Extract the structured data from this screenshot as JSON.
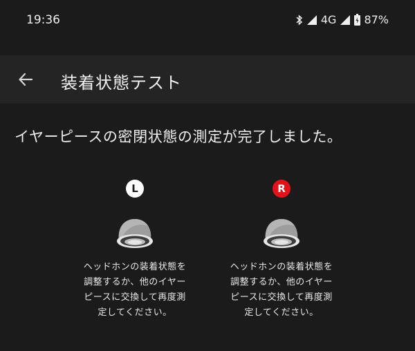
{
  "status_bar": {
    "time": "19:36",
    "network": "4G",
    "battery": "87%"
  },
  "app_bar": {
    "title": "装着状態テスト"
  },
  "main": {
    "message": "イヤーピースの密閉状態の測定が完了しました。"
  },
  "left": {
    "badge": "L",
    "message_lines": [
      "ヘッドホンの装着状態を",
      "調整するか、他のイヤー",
      "ピースに交換して再度測",
      "定してください。"
    ]
  },
  "right": {
    "badge": "R",
    "message_lines": [
      "ヘッドホンの装着状態を",
      "調整するか、他のイヤー",
      "ピースに交換して再度測",
      "定してください。"
    ]
  },
  "colors": {
    "background": "#1b1b1b",
    "app_bar": "#242424",
    "right_badge": "#e3121a"
  }
}
